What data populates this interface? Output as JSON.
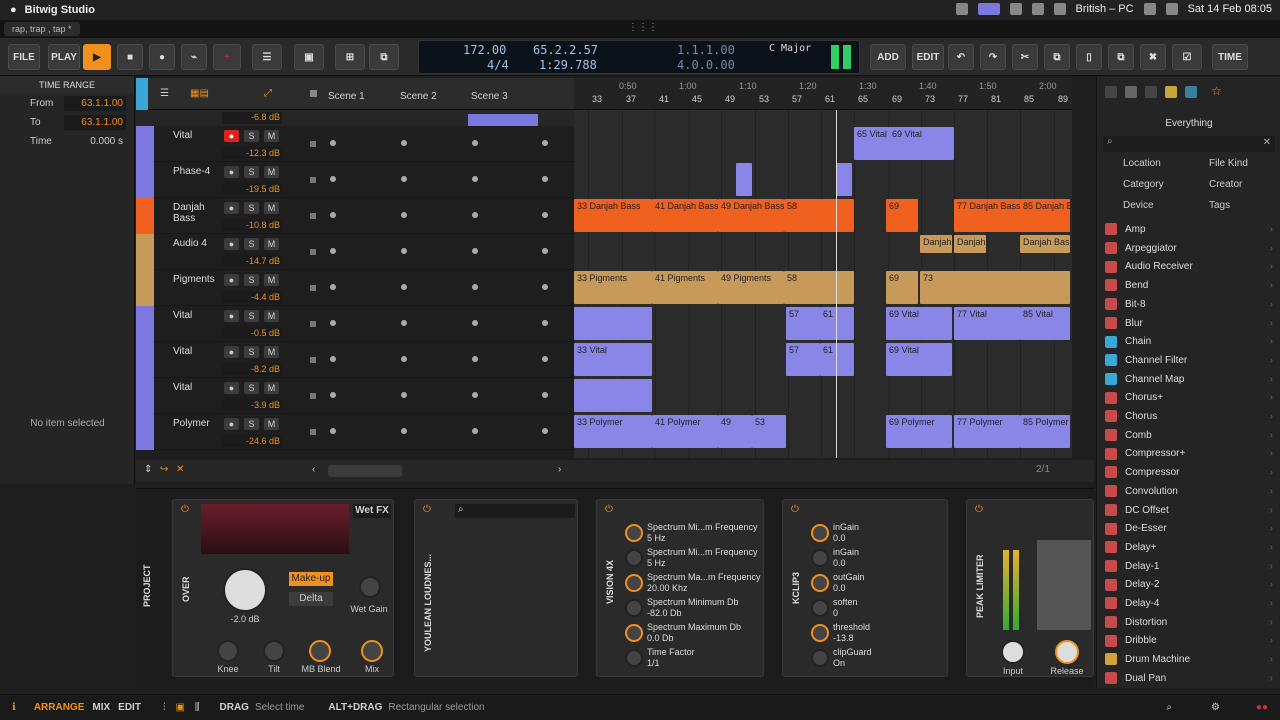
{
  "macbar": {
    "app_name": "Bitwig Studio",
    "status": "British – PC",
    "datetime": "Sat 14 Feb  08:05"
  },
  "document_tab": "rap, trap , tap *",
  "toolbar": {
    "file": "FILE",
    "play": "PLAY",
    "add": "ADD",
    "edit": "EDIT",
    "time": "TIME"
  },
  "transport": {
    "tempo": "172.00",
    "signature": "4/4",
    "position": "65.2.2.57",
    "time": "1:29.788",
    "loop_start": "1.1.1.00",
    "loop_len": "4.0.0.00",
    "key": "C Major"
  },
  "time_range": {
    "title": "TIME RANGE",
    "from_label": "From",
    "from": "63.1.1.00",
    "to_label": "To",
    "to": "63.1.1.00",
    "time_label": "Time",
    "time": "0.000 s"
  },
  "no_item": "No item selected",
  "scenes": [
    "Scene 1",
    "Scene 2",
    "Scene 3"
  ],
  "ruler": {
    "bars": [
      "33",
      "37",
      "41",
      "45",
      "49",
      "53",
      "57",
      "61",
      "65",
      "69",
      "73",
      "77",
      "81",
      "85",
      "89"
    ],
    "times": [
      "0:50",
      "1:00",
      "1:10",
      "1:20",
      "1:30",
      "1:40",
      "1:50",
      "2:00"
    ]
  },
  "tracks": [
    {
      "name": "Vital",
      "vol": "-12.3 dB",
      "color": "#7b78e0"
    },
    {
      "name": "Phase-4",
      "vol": "-19.5 dB",
      "color": "#7b78e0"
    },
    {
      "name": "Danjah Bass",
      "vol": "-10.8 dB",
      "color": "#f06020"
    },
    {
      "name": "Audio 4",
      "vol": "-14.7 dB",
      "color": "#c79a5a"
    },
    {
      "name": "Pigments",
      "vol": "-4.4 dB",
      "color": "#c79a5a"
    },
    {
      "name": "Vital",
      "vol": "-0.5 dB",
      "color": "#7b78e0"
    },
    {
      "name": "Vital",
      "vol": "-8.2 dB",
      "color": "#7b78e0"
    },
    {
      "name": "Vital",
      "vol": "-3.9 dB",
      "color": "#7b78e0"
    },
    {
      "name": "Polymer",
      "vol": "-24.6 dB",
      "color": "#7b78e0"
    }
  ],
  "top_vol": "-6.8 dB",
  "clips": {
    "vital1": "65 Vital",
    "vital1b": "69 Vital",
    "db33": "33 Danjah Bass",
    "db41": "41 Danjah Bass",
    "db49": "49 Danjah Bass",
    "db58": "58",
    "db69": "69",
    "db77": "77 Danjah Bass",
    "db85": "85 Danjah Bass",
    "au1": "Danjah",
    "au2": "Danjah",
    "au3": "Danjah Bas",
    "pg33": "33 Pigments",
    "pg41": "41 Pigments",
    "pg49": "49 Pigments",
    "pg58": "58",
    "pg69": "69",
    "pg73": "73",
    "v57": "57",
    "v61": "61",
    "v69": "69 Vital",
    "v77": "77 Vital",
    "v85": "85 Vital",
    "v33": "33 Vital",
    "v2_57": "57",
    "v2_61": "61",
    "v2_69": "69 Vital",
    "p33": "33 Polymer",
    "p41": "41 Polymer",
    "p49": "49",
    "p53": "53",
    "p69": "69 Polymer",
    "p77": "77 Polymer",
    "p85": "85 Polymer",
    "page": "2/1"
  },
  "browser": {
    "title": "Everything",
    "filters": [
      "Location",
      "File Kind",
      "Category",
      "Creator",
      "Device",
      "Tags"
    ],
    "items": [
      {
        "name": "Amp",
        "color": "#c94a4a"
      },
      {
        "name": "Arpeggiator",
        "color": "#c94a4a"
      },
      {
        "name": "Audio Receiver",
        "color": "#c94a4a"
      },
      {
        "name": "Bend",
        "color": "#c94a4a"
      },
      {
        "name": "Bit-8",
        "color": "#c94a4a"
      },
      {
        "name": "Blur",
        "color": "#c94a4a"
      },
      {
        "name": "Chain",
        "color": "#3aa7d6"
      },
      {
        "name": "Channel Filter",
        "color": "#3aa7d6"
      },
      {
        "name": "Channel Map",
        "color": "#3aa7d6"
      },
      {
        "name": "Chorus+",
        "color": "#c94a4a"
      },
      {
        "name": "Chorus",
        "color": "#c94a4a"
      },
      {
        "name": "Comb",
        "color": "#c94a4a"
      },
      {
        "name": "Compressor+",
        "color": "#c94a4a"
      },
      {
        "name": "Compressor",
        "color": "#c94a4a"
      },
      {
        "name": "Convolution",
        "color": "#c94a4a"
      },
      {
        "name": "DC Offset",
        "color": "#c94a4a"
      },
      {
        "name": "De-Esser",
        "color": "#c94a4a"
      },
      {
        "name": "Delay+",
        "color": "#c94a4a"
      },
      {
        "name": "Delay-1",
        "color": "#c94a4a"
      },
      {
        "name": "Delay-2",
        "color": "#c94a4a"
      },
      {
        "name": "Delay-4",
        "color": "#c94a4a"
      },
      {
        "name": "Distortion",
        "color": "#c94a4a"
      },
      {
        "name": "Dribble",
        "color": "#c94a4a"
      },
      {
        "name": "Drum Machine",
        "color": "#d1a23a"
      },
      {
        "name": "Dual Pan",
        "color": "#c94a4a"
      }
    ]
  },
  "devices": {
    "project": "PROJECT",
    "over": "OVER",
    "wet_fx": "Wet FX",
    "gain": "-2.0 dB",
    "makeup": "Make-up",
    "delta": "Delta",
    "wet_gain": "Wet Gain",
    "knee": "Knee",
    "tilt": "Tilt",
    "mb_blend": "MB Blend",
    "mix": "Mix",
    "youlean": "YOULEAN LOUDNES...",
    "vision": "VISION 4X",
    "kclip": "KCLIP3",
    "peak": "PEAK LIMITER",
    "input": "Input",
    "release": "Release",
    "vision_params": [
      {
        "n": "Spectrum Mi...m Frequency",
        "v": "5 Hz"
      },
      {
        "n": "Spectrum Mi...m Frequency",
        "v": "5 Hz"
      },
      {
        "n": "Spectrum Ma...m Frequency",
        "v": "20.00 Khz"
      },
      {
        "n": "Spectrum Minimum Db",
        "v": "-82.0 Db"
      },
      {
        "n": "Spectrum Maximum Db",
        "v": "0.0 Db"
      },
      {
        "n": "Time Factor",
        "v": "1/1"
      }
    ],
    "kclip_params": [
      {
        "n": "inGain",
        "v": "0.0"
      },
      {
        "n": "inGain",
        "v": "0.0"
      },
      {
        "n": "outGain",
        "v": "0.0"
      },
      {
        "n": "soften",
        "v": "0"
      },
      {
        "n": "threshold",
        "v": "-13.8"
      },
      {
        "n": "clipGuard",
        "v": "On"
      }
    ]
  },
  "statusbar": {
    "arrange": "ARRANGE",
    "mix": "MIX",
    "edit": "EDIT",
    "drag": "DRAG",
    "drag_hint": "Select time",
    "alt": "ALT+DRAG",
    "alt_hint": "Rectangular selection"
  }
}
